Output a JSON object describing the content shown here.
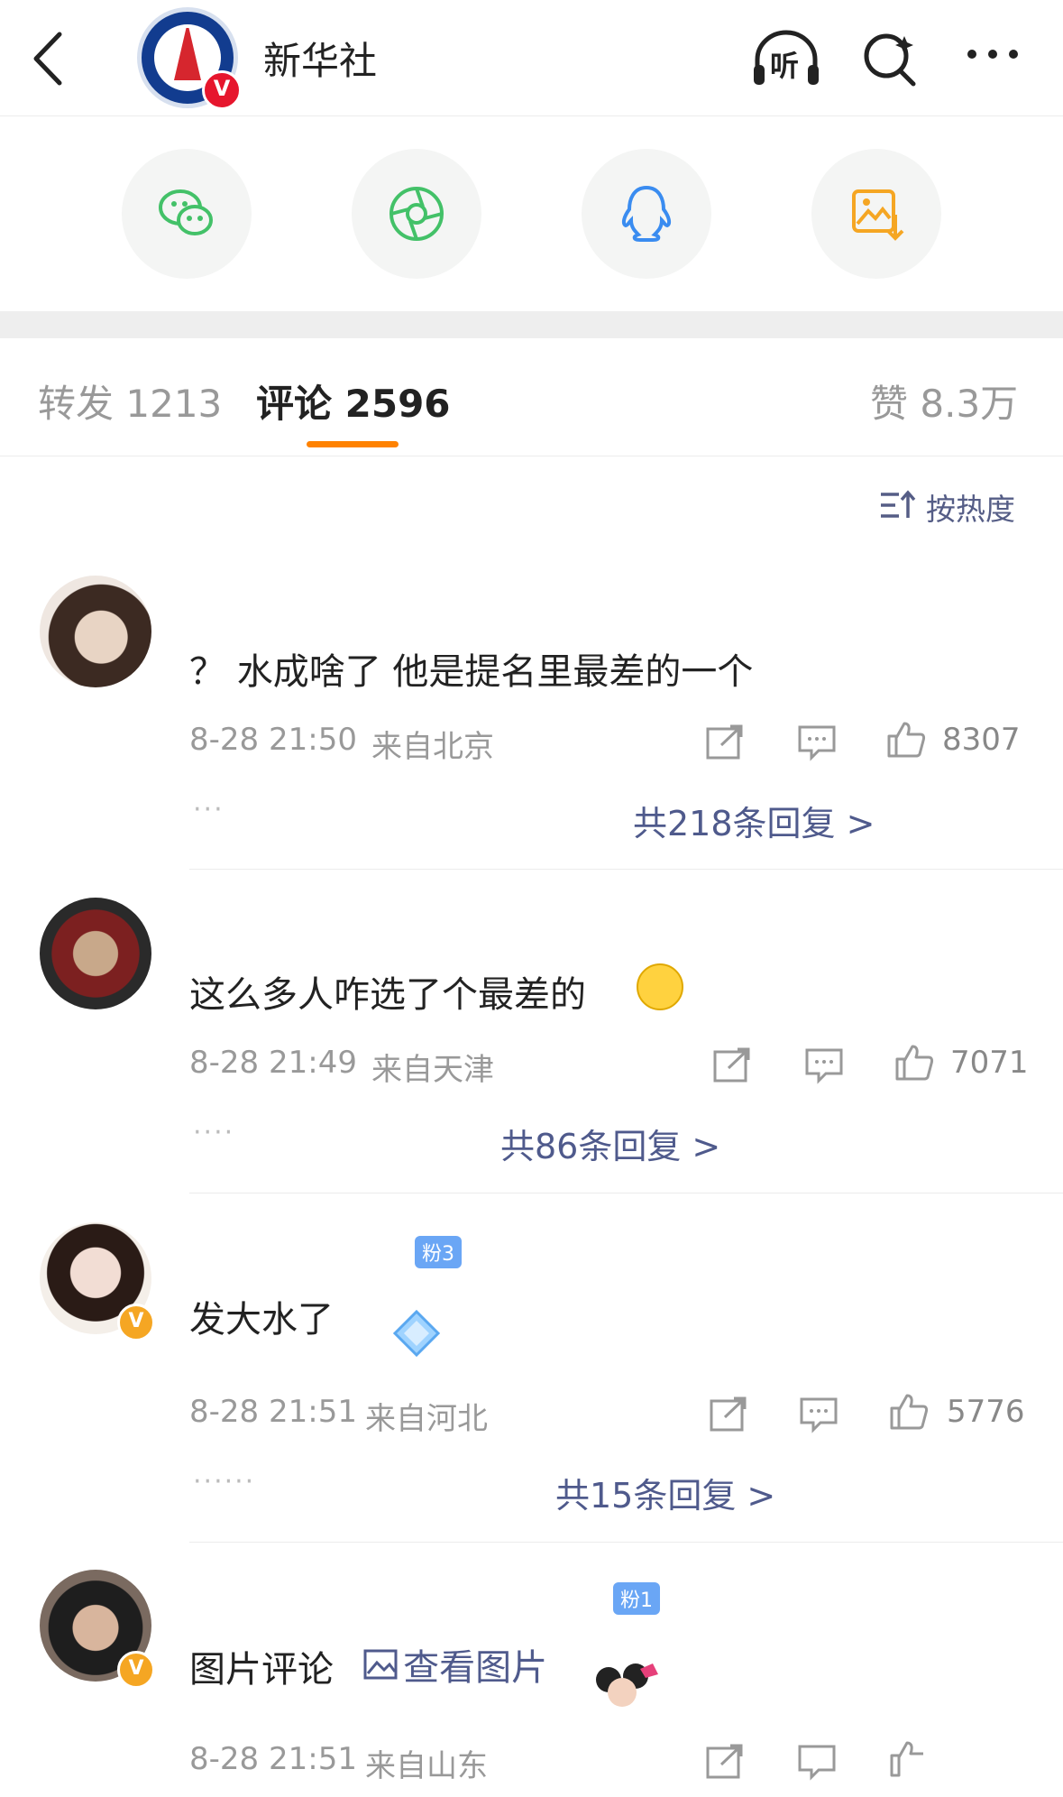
{
  "header": {
    "back_icon": "chevron-left-icon",
    "account_name": "新华社",
    "avatar_badge": "V",
    "icons": [
      "listen-icon",
      "search-icon",
      "more-icon"
    ],
    "listen_glyph": "听"
  },
  "share": {
    "items": [
      "wechat-icon",
      "moments-icon",
      "qq-icon",
      "save-image-icon"
    ]
  },
  "tabs": {
    "repost_label": "转发",
    "repost_count": "1213",
    "comment_label": "评论",
    "comment_count": "2596",
    "like_label": "赞",
    "like_count": "8.3万",
    "accent": "#ff8200"
  },
  "sort": {
    "label": "按热度"
  },
  "comments": [
    {
      "text": "？ 水成啥了 他是提名里最差的一个",
      "time": "8-28 21:50",
      "location": "来自北京",
      "likes": "8307",
      "replies": "共218条回复 >"
    },
    {
      "text": "这么多人咋选了个最差的",
      "emoji": "laughing-crying-emoji",
      "time": "8-28 21:49",
      "location": "来自天津",
      "likes": "7071",
      "replies": "共86条回复 >"
    },
    {
      "text": "发大水了",
      "badge": "粉3",
      "verified": "V",
      "time": "8-28 21:51",
      "location": "来自河北",
      "likes": "5776",
      "replies": "共15条回复 >"
    },
    {
      "text": "图片评论",
      "link": "查看图片",
      "badge": "粉1",
      "verified": "V",
      "time": "8-28 21:51",
      "location": "来自山东",
      "likes": ""
    }
  ],
  "colors": {
    "link": "#4f5a8c",
    "meta": "#999999",
    "wechat": "#43c168",
    "qq": "#3a8cf0",
    "save": "#f5a623"
  }
}
